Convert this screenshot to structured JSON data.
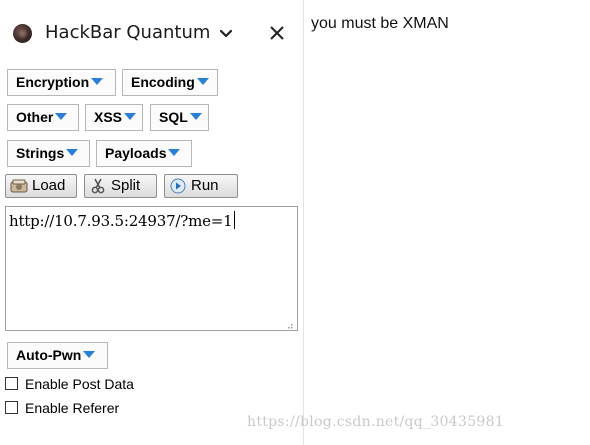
{
  "sidebar": {
    "title": "HackBar Quantum",
    "menus": {
      "encryption": "Encryption",
      "encoding": "Encoding",
      "other": "Other",
      "xss": "XSS",
      "sql": "SQL",
      "strings": "Strings",
      "payloads": "Payloads",
      "autopwn": "Auto-Pwn"
    },
    "buttons": {
      "load": "Load",
      "split": "Split",
      "run": "Run"
    },
    "url_value": "http://10.7.93.5:24937/?me=1",
    "checkboxes": [
      {
        "label": "Enable Post Data",
        "checked": false
      },
      {
        "label": "Enable Referer",
        "checked": false
      }
    ]
  },
  "page": {
    "text": "you must be XMAN"
  },
  "watermark": "https://blog.csdn.net/qq_30435981",
  "colors": {
    "dropdown_arrow": "#2a7fd4"
  }
}
